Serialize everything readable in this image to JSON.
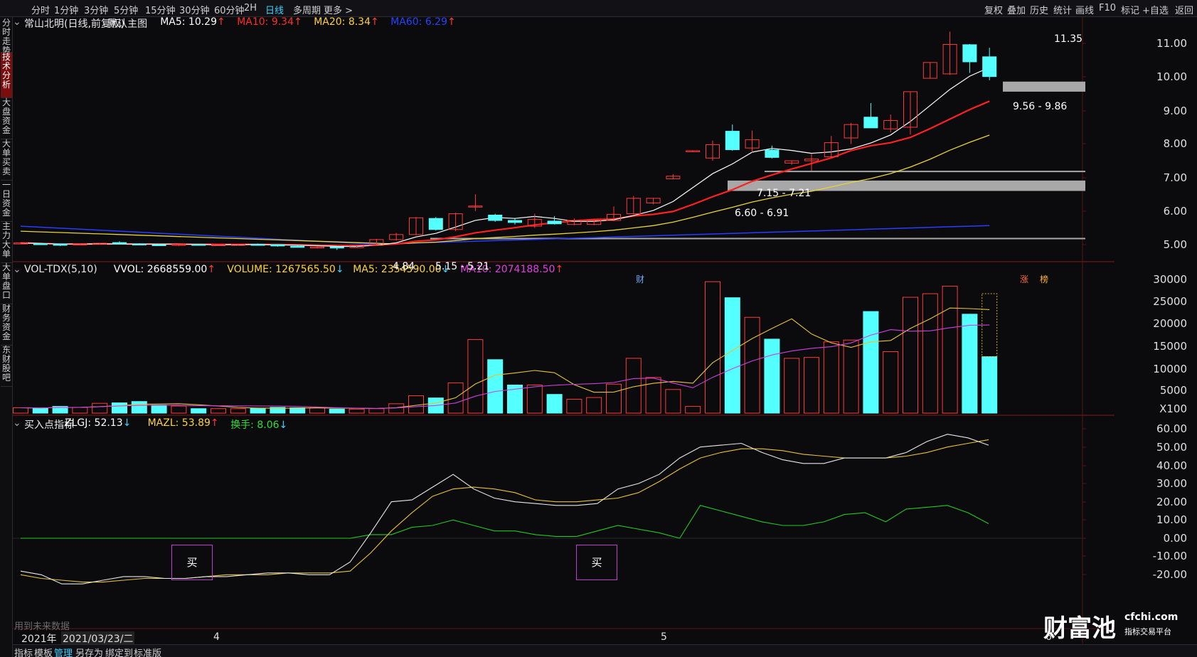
{
  "toolbar": {
    "timeframes": [
      "分时",
      "1分钟",
      "3分钟",
      "5分钟",
      "15分钟",
      "30分钟",
      "60分钟",
      "2H",
      "日线",
      "多周期",
      "更多 >"
    ],
    "active": "日线",
    "right": [
      "复权",
      "叠加",
      "历史",
      "统计",
      "画线",
      "F10",
      "标记",
      "+自选",
      "返回"
    ]
  },
  "sidebar": [
    "分时走势",
    "技术分析",
    "大盘资金",
    "大单买卖",
    "一日资金",
    "主力大单",
    "大单盘口",
    "财务资金",
    "东财股吧"
  ],
  "main": {
    "stock": "常山北明(日线,前复权)",
    "template": "默认主图",
    "ma": [
      {
        "label": "MA5: 10.29",
        "arrow": "↑",
        "color": "#ffffff"
      },
      {
        "label": "MA10: 9.34",
        "arrow": "↑",
        "color": "#ff2b2b"
      },
      {
        "label": "MA20: 8.34",
        "arrow": "↑",
        "color": "#ffd23a"
      },
      {
        "label": "MA60: 6.29",
        "arrow": "↑",
        "color": "#2443ff"
      }
    ],
    "axis": [
      "11.00",
      "10.00",
      "9.00",
      "8.00",
      "7.00",
      "6.00",
      "5.00"
    ],
    "high_label": "11.35",
    "low_label": "4.84",
    "zones": [
      "9.56 - 9.86",
      "7.15 - 7.21",
      "6.60 - 6.91",
      "5.15 - 5.21"
    ],
    "markers": [
      "财",
      "涨",
      "榜"
    ]
  },
  "volume": {
    "title": "VOL-TDX(5,10)",
    "items": [
      {
        "label": "VVOL: 2668559.00",
        "arrow": "↑",
        "color": "#ffffff"
      },
      {
        "label": "VOLUME: 1267565.50",
        "arrow": "↓",
        "color": "#ffd23a"
      },
      {
        "label": "MA5: 2354590.00",
        "arrow": "↓",
        "color": "#ffd23a"
      },
      {
        "label": "MA10: 2074188.50",
        "arrow": "↑",
        "color": "#e040e0"
      }
    ],
    "axis": [
      "30000",
      "25000",
      "20000",
      "15000",
      "10000",
      "5000",
      "X100"
    ]
  },
  "indicator": {
    "title": "买入点指标",
    "items": [
      {
        "label": "ZLGJ: 52.13",
        "arrow": "↓",
        "color": "#ffffff"
      },
      {
        "label": "MAZL: 53.89",
        "arrow": "↑",
        "color": "#ffd23a"
      },
      {
        "label": "换手: 8.06",
        "arrow": "↓",
        "color": "#33dd33"
      }
    ],
    "axis": [
      "60.00",
      "50.00",
      "40.00",
      "30.00",
      "20.00",
      "10.00",
      "0.00",
      "-10.00",
      "-20.00"
    ],
    "buy_label": "买"
  },
  "xaxis": {
    "year": "2021年",
    "date": "2021/03/23/二",
    "months": [
      "4",
      "5",
      "6"
    ],
    "watermark": "用到未来数据"
  },
  "bottombar": {
    "items": [
      "指标",
      "模板",
      "管理",
      "另存为",
      "绑定到",
      "标准版"
    ],
    "active": "管理"
  },
  "logo": {
    "brand": "财富池",
    "site": "cfchi.com",
    "sub": "指标交易平台"
  },
  "colors": {
    "up": "#ff3b3b",
    "down": "#54ffff",
    "ma5": "#ffffff",
    "ma10": "#ff2020",
    "ma20": "#e8d23a",
    "ma60": "#2a3cff",
    "zone": "#a8a8a8",
    "grid": "#5a1515"
  },
  "chart_data": {
    "type": "candlestick",
    "ohlc": [
      {
        "o": 5.05,
        "h": 5.07,
        "l": 5.01,
        "c": 5.05
      },
      {
        "o": 5.03,
        "h": 5.05,
        "l": 5.0,
        "c": 5.02
      },
      {
        "o": 5.02,
        "h": 5.03,
        "l": 4.96,
        "c": 4.98
      },
      {
        "o": 5.0,
        "h": 5.04,
        "l": 4.98,
        "c": 5.02
      },
      {
        "o": 5.02,
        "h": 5.05,
        "l": 5.0,
        "c": 5.04
      },
      {
        "o": 5.06,
        "h": 5.1,
        "l": 5.02,
        "c": 5.02
      },
      {
        "o": 5.02,
        "h": 5.04,
        "l": 4.98,
        "c": 5.0
      },
      {
        "o": 5.0,
        "h": 5.02,
        "l": 4.97,
        "c": 4.99
      },
      {
        "o": 4.98,
        "h": 5.03,
        "l": 4.96,
        "c": 5.01
      },
      {
        "o": 5.01,
        "h": 5.02,
        "l": 4.98,
        "c": 4.99
      },
      {
        "o": 4.99,
        "h": 5.01,
        "l": 4.97,
        "c": 5.0
      },
      {
        "o": 5.0,
        "h": 5.02,
        "l": 4.98,
        "c": 5.01
      },
      {
        "o": 5.01,
        "h": 5.03,
        "l": 4.98,
        "c": 5.0
      },
      {
        "o": 5.0,
        "h": 5.01,
        "l": 4.94,
        "c": 4.96
      },
      {
        "o": 4.95,
        "h": 4.98,
        "l": 4.93,
        "c": 4.94
      },
      {
        "o": 4.92,
        "h": 4.96,
        "l": 4.89,
        "c": 4.93
      },
      {
        "o": 4.93,
        "h": 4.95,
        "l": 4.84,
        "c": 4.91
      },
      {
        "o": 4.91,
        "h": 5.0,
        "l": 4.9,
        "c": 4.98
      },
      {
        "o": 4.98,
        "h": 5.17,
        "l": 4.97,
        "c": 5.15
      },
      {
        "o": 5.15,
        "h": 5.35,
        "l": 5.12,
        "c": 5.3
      },
      {
        "o": 5.3,
        "h": 5.82,
        "l": 5.28,
        "c": 5.8
      },
      {
        "o": 5.78,
        "h": 5.82,
        "l": 5.42,
        "c": 5.45
      },
      {
        "o": 5.45,
        "h": 5.95,
        "l": 5.4,
        "c": 5.92
      },
      {
        "o": 6.12,
        "h": 6.5,
        "l": 6.0,
        "c": 6.15
      },
      {
        "o": 5.88,
        "h": 5.92,
        "l": 5.68,
        "c": 5.72
      },
      {
        "o": 5.72,
        "h": 5.78,
        "l": 5.6,
        "c": 5.66
      },
      {
        "o": 5.55,
        "h": 5.92,
        "l": 5.5,
        "c": 5.75
      },
      {
        "o": 5.7,
        "h": 5.85,
        "l": 5.6,
        "c": 5.62
      },
      {
        "o": 5.6,
        "h": 5.78,
        "l": 5.58,
        "c": 5.72
      },
      {
        "o": 5.6,
        "h": 5.73,
        "l": 5.58,
        "c": 5.72
      },
      {
        "o": 5.72,
        "h": 6.14,
        "l": 5.7,
        "c": 5.9
      },
      {
        "o": 5.92,
        "h": 6.45,
        "l": 5.9,
        "c": 6.38
      },
      {
        "o": 6.24,
        "h": 6.38,
        "l": 6.2,
        "c": 6.38
      },
      {
        "o": 6.96,
        "h": 7.1,
        "l": 6.95,
        "c": 7.04
      },
      {
        "o": 7.8,
        "h": 7.8,
        "l": 7.78,
        "c": 7.8
      },
      {
        "o": 7.58,
        "h": 8.1,
        "l": 7.5,
        "c": 7.98
      },
      {
        "o": 8.38,
        "h": 8.58,
        "l": 7.8,
        "c": 7.83
      },
      {
        "o": 7.88,
        "h": 8.4,
        "l": 7.75,
        "c": 8.13
      },
      {
        "o": 7.82,
        "h": 7.95,
        "l": 7.57,
        "c": 7.6
      },
      {
        "o": 7.43,
        "h": 7.5,
        "l": 7.38,
        "c": 7.5
      },
      {
        "o": 7.5,
        "h": 7.7,
        "l": 7.2,
        "c": 7.55
      },
      {
        "o": 7.62,
        "h": 8.24,
        "l": 7.6,
        "c": 8.04
      },
      {
        "o": 8.18,
        "h": 8.63,
        "l": 8.0,
        "c": 8.58
      },
      {
        "o": 8.8,
        "h": 9.22,
        "l": 8.48,
        "c": 8.48
      },
      {
        "o": 8.45,
        "h": 8.88,
        "l": 8.35,
        "c": 8.7
      },
      {
        "o": 8.5,
        "h": 9.57,
        "l": 8.28,
        "c": 9.56
      },
      {
        "o": 9.96,
        "h": 10.43,
        "l": 9.95,
        "c": 10.43
      },
      {
        "o": 10.09,
        "h": 11.35,
        "l": 10.06,
        "c": 10.97
      },
      {
        "o": 10.96,
        "h": 10.98,
        "l": 10.12,
        "c": 10.45
      },
      {
        "o": 10.6,
        "h": 10.87,
        "l": 9.9,
        "c": 10.01
      }
    ],
    "volume_x100": [
      1200,
      1100,
      1500,
      1300,
      2200,
      2300,
      2600,
      1800,
      1600,
      1000,
      1000,
      1000,
      1100,
      1300,
      1200,
      1200,
      900,
      900,
      1000,
      2100,
      3900,
      3400,
      6800,
      16500,
      12000,
      6300,
      6300,
      4200,
      3100,
      3500,
      6500,
      12300,
      8000,
      5300,
      1500,
      29500,
      25900,
      21500,
      16600,
      12300,
      12500,
      16000,
      16400,
      22800,
      13800,
      26000,
      26800,
      28500,
      22200,
      12676
    ],
    "indicator_zlgj": [
      -18,
      -20,
      -25,
      -25,
      -23,
      -21,
      -21,
      -22,
      -22,
      -21,
      -21,
      -20,
      -19,
      -19,
      -20,
      -20,
      -13,
      3,
      20,
      21,
      28,
      35,
      27,
      22,
      20,
      19,
      18,
      18,
      19,
      27,
      30,
      35,
      44,
      50,
      51,
      52,
      47,
      43,
      41,
      41,
      44,
      44,
      44,
      47,
      53,
      57,
      55,
      51
    ],
    "indicator_mazl": [
      -20,
      -22,
      -23,
      -24,
      -24,
      -23,
      -22,
      -22,
      -22,
      -21,
      -20,
      -20,
      -20,
      -19,
      -19,
      -19,
      -18,
      -8,
      4,
      14,
      23,
      27,
      28,
      27,
      25,
      21,
      20,
      20,
      21,
      22,
      25,
      31,
      38,
      44,
      47,
      49,
      49,
      48,
      46,
      45,
      44,
      44,
      44,
      45,
      47,
      50,
      52,
      54
    ],
    "indicator_turnover": [
      0,
      0,
      0,
      0,
      0,
      0,
      0,
      0,
      0,
      0,
      0,
      0,
      0,
      0,
      0,
      0,
      0,
      2,
      2,
      6,
      7,
      10,
      7,
      4,
      4,
      2,
      1,
      1,
      4,
      7,
      5,
      3,
      0,
      18,
      15,
      12,
      9,
      7,
      7,
      9,
      13,
      14,
      9,
      16,
      17,
      18,
      14,
      8
    ]
  }
}
